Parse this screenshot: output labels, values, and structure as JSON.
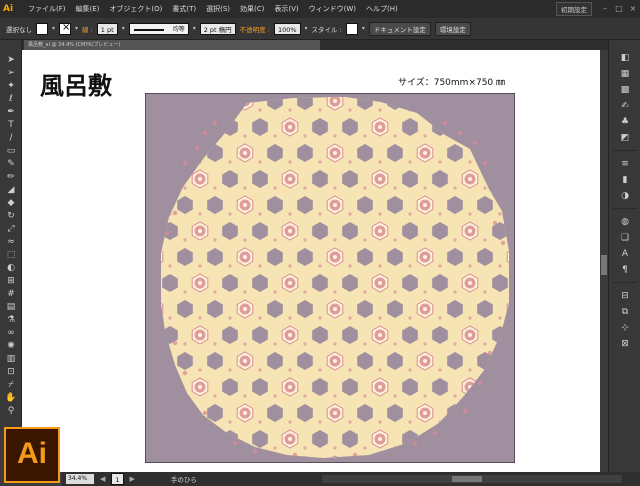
{
  "menubar": {
    "app_logo": "Ai",
    "menus": [
      "ファイル(F)",
      "編集(E)",
      "オブジェクト(O)",
      "書式(T)",
      "選択(S)",
      "効果(C)",
      "表示(V)",
      "ウィンドウ(W)",
      "ヘルプ(H)"
    ],
    "workspace": "初期設定"
  },
  "controlbar": {
    "selection": "選択なし",
    "stroke_label": "線 :",
    "stroke_weight": "1 pt",
    "stroke_profile": "均等",
    "brush": "2 pt 楕円",
    "opacity_label": "不透明度 :",
    "opacity_value": "100%",
    "style_label": "スタイル :",
    "doc_setup_btn": "ドキュメント設定",
    "prefs_btn": "環境設定"
  },
  "document": {
    "tab_title": "風呂敷_ai @ 34.4% (CMYK/プレビュー)",
    "heading": "風呂敷",
    "size_text": "サイズ：750mm×750 ㎜"
  },
  "statusbar": {
    "zoom": "34.4%",
    "page": "1",
    "tool": "手のひら"
  },
  "logo": {
    "text": "Ai",
    "color": "#f39c1a"
  },
  "artwork": {
    "background_color": "#9f8f9f",
    "pattern_color": "#f7e4b4",
    "hexagon_color": "#9f8f9f",
    "flower_color": "#d98b94"
  }
}
